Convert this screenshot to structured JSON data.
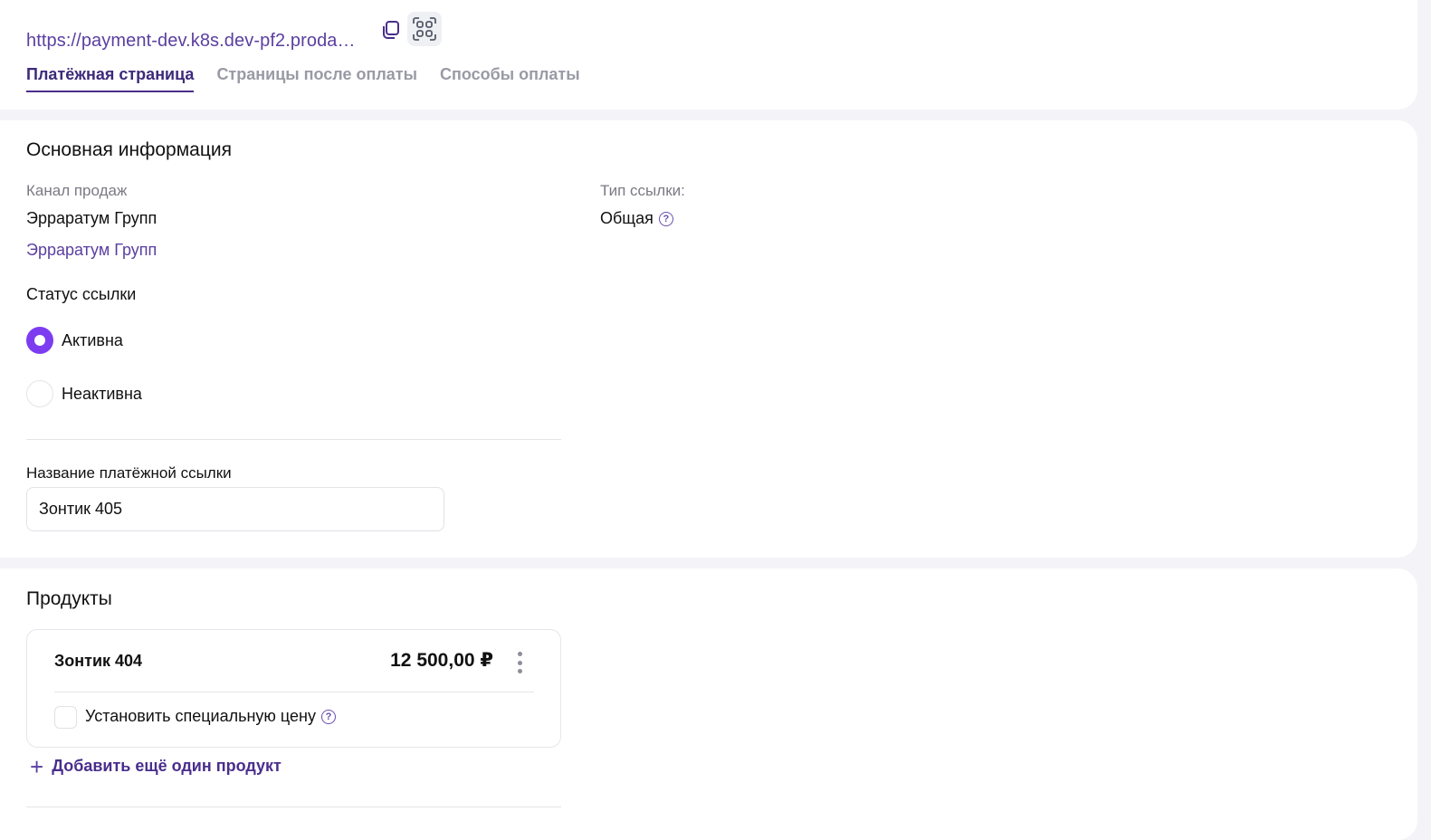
{
  "link": {
    "url": "https://payment-dev.k8s.dev-pf2.proda…",
    "copy_icon": "copy-icon",
    "qr_icon": "qr-code-icon"
  },
  "tabs": [
    {
      "label": "Платёжная страница",
      "active": true
    },
    {
      "label": "Страницы после оплаты",
      "active": false
    },
    {
      "label": "Способы оплаты",
      "active": false
    }
  ],
  "main": {
    "title": "Основная информация",
    "sales_channel_label": "Канал продаж",
    "sales_channel_value": "Эрраратум Групп",
    "sales_channel_link": "Эрраратум Групп",
    "link_type_label": "Тип ссылки:",
    "link_type_value": "Общая",
    "status_label": "Статус ссылки",
    "status_options": [
      {
        "label": "Активна",
        "selected": true
      },
      {
        "label": "Неактивна",
        "selected": false
      }
    ],
    "name_label": "Название платёжной ссылки",
    "name_value": "Зонтик 405"
  },
  "products": {
    "title": "Продукты",
    "items": [
      {
        "name": "Зонтик 404",
        "price": "12 500,00 ₽",
        "special_price_label": "Установить специальную цену",
        "special_price_checked": false
      }
    ],
    "add_label": "Добавить ещё один продукт"
  },
  "colors": {
    "accent": "#7d3cf0",
    "link": "#5b3fa0",
    "background": "#f4f4f8"
  }
}
